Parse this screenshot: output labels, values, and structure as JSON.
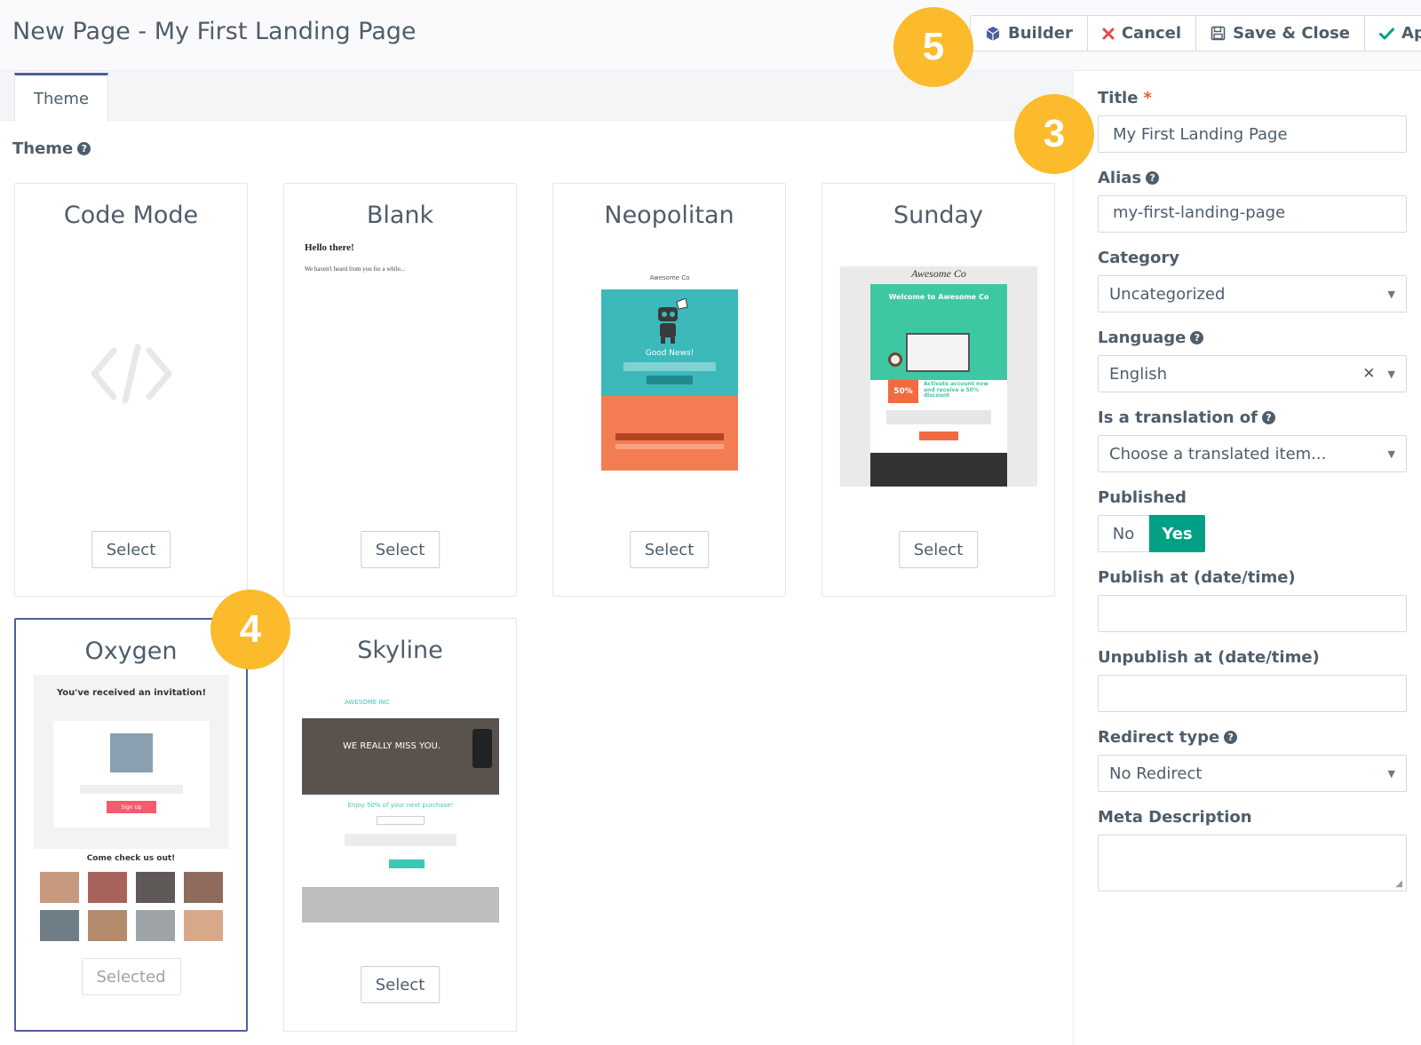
{
  "header": {
    "title": "New Page - My First Landing Page",
    "toolbar": {
      "builder": "Builder",
      "cancel": "Cancel",
      "save_close": "Save & Close",
      "apply": "Apply"
    }
  },
  "markers": {
    "m5": "5",
    "m3": "3",
    "m4": "4"
  },
  "tabs": [
    {
      "label": "Theme"
    }
  ],
  "theme_section": {
    "label": "Theme"
  },
  "themes": [
    {
      "name": "Code Mode",
      "button": "Select"
    },
    {
      "name": "Blank",
      "button": "Select",
      "preview_heading": "Hello there!",
      "preview_text": "We haven't heard from you for a while..."
    },
    {
      "name": "Neopolitan",
      "button": "Select",
      "preview_brand": "Awesome Co",
      "preview_news": "Good News!"
    },
    {
      "name": "Sunday",
      "button": "Select",
      "preview_brand": "Awesome Co",
      "preview_welcome": "Welcome to Awesome Co",
      "preview_badge": "50%",
      "preview_offer": "Activate account now and receive a 50% discount"
    },
    {
      "name": "Oxygen",
      "button": "Selected",
      "preview_heading": "You've received an invitation!",
      "preview_sub": "Come check us out!",
      "preview_cta": "Sign Up"
    },
    {
      "name": "Skyline",
      "button": "Select",
      "preview_brand": "AWESOME INC",
      "preview_hero": "WE REALLY MISS YOU.",
      "preview_offer": "Enjoy 50% of your next purchase!"
    }
  ],
  "form": {
    "title_label": "Title",
    "title_value": "My First Landing Page",
    "alias_label": "Alias",
    "alias_value": "my-first-landing-page",
    "category_label": "Category",
    "category_value": "Uncategorized",
    "language_label": "Language",
    "language_value": "English",
    "translation_label": "Is a translation of",
    "translation_placeholder": "Choose a translated item...",
    "published_label": "Published",
    "published_no": "No",
    "published_yes": "Yes",
    "publish_at_label": "Publish at (date/time)",
    "unpublish_at_label": "Unpublish at (date/time)",
    "redirect_label": "Redirect type",
    "redirect_value": "No Redirect",
    "meta_label": "Meta Description"
  },
  "colors": {
    "accent": "#4e5e9e",
    "marker": "#fbbb2c",
    "success": "#00a085",
    "danger": "#e14d43"
  }
}
